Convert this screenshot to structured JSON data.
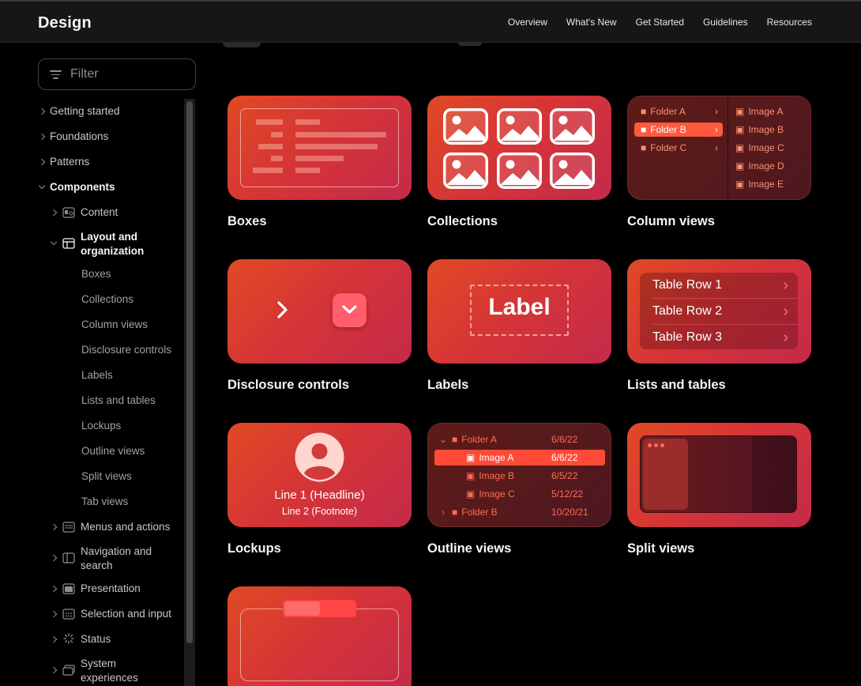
{
  "header": {
    "brand": "Design",
    "nav": [
      "Overview",
      "What's New",
      "Get Started",
      "Guidelines",
      "Resources"
    ]
  },
  "sidebar": {
    "filter_placeholder": "Filter",
    "items": {
      "getting_started": "Getting started",
      "foundations": "Foundations",
      "patterns": "Patterns",
      "components": "Components",
      "content": "Content",
      "layout_line1": "Layout and",
      "layout_line2": "organization",
      "boxes": "Boxes",
      "collections": "Collections",
      "column_views": "Column views",
      "disclosure_controls": "Disclosure controls",
      "labels": "Labels",
      "lists_and_tables": "Lists and tables",
      "lockups": "Lockups",
      "outline_views": "Outline views",
      "split_views": "Split views",
      "tab_views": "Tab views",
      "menus_and_actions": "Menus and actions",
      "navigation_line1": "Navigation and",
      "navigation_line2": "search",
      "presentation": "Presentation",
      "selection_and_input": "Selection and input",
      "status": "Status",
      "system_line1": "System",
      "system_line2": "experiences"
    }
  },
  "cards": {
    "boxes": "Boxes",
    "collections": "Collections",
    "column_views": "Column views",
    "disclosure_controls": "Disclosure controls",
    "labels": "Labels",
    "lists_and_tables": "Lists and tables",
    "lockups": "Lockups",
    "outline_views": "Outline views",
    "split_views": "Split views"
  },
  "column_view": {
    "folders": [
      "Folder A",
      "Folder B",
      "Folder C"
    ],
    "images": [
      "Image A",
      "Image B",
      "Image C",
      "Image D",
      "Image E"
    ]
  },
  "label_card": {
    "text": "Label"
  },
  "table_rows": [
    "Table Row 1",
    "Table Row 2",
    "Table Row 3"
  ],
  "lockup": {
    "headline": "Line 1 (Headline)",
    "footnote": "Line 2 (Footnote)"
  },
  "outline_view": {
    "rows": [
      {
        "name": "Folder A",
        "date": "6/6/22"
      },
      {
        "name": "Image A",
        "date": "6/6/22"
      },
      {
        "name": "Image B",
        "date": "6/5/22"
      },
      {
        "name": "Image C",
        "date": "5/12/22"
      },
      {
        "name": "Folder B",
        "date": "10/20/21"
      }
    ]
  },
  "colors": {
    "accent": "#ff5a3c",
    "card_gradient_start": "#e04a24",
    "card_gradient_end": "#c42a4a"
  }
}
